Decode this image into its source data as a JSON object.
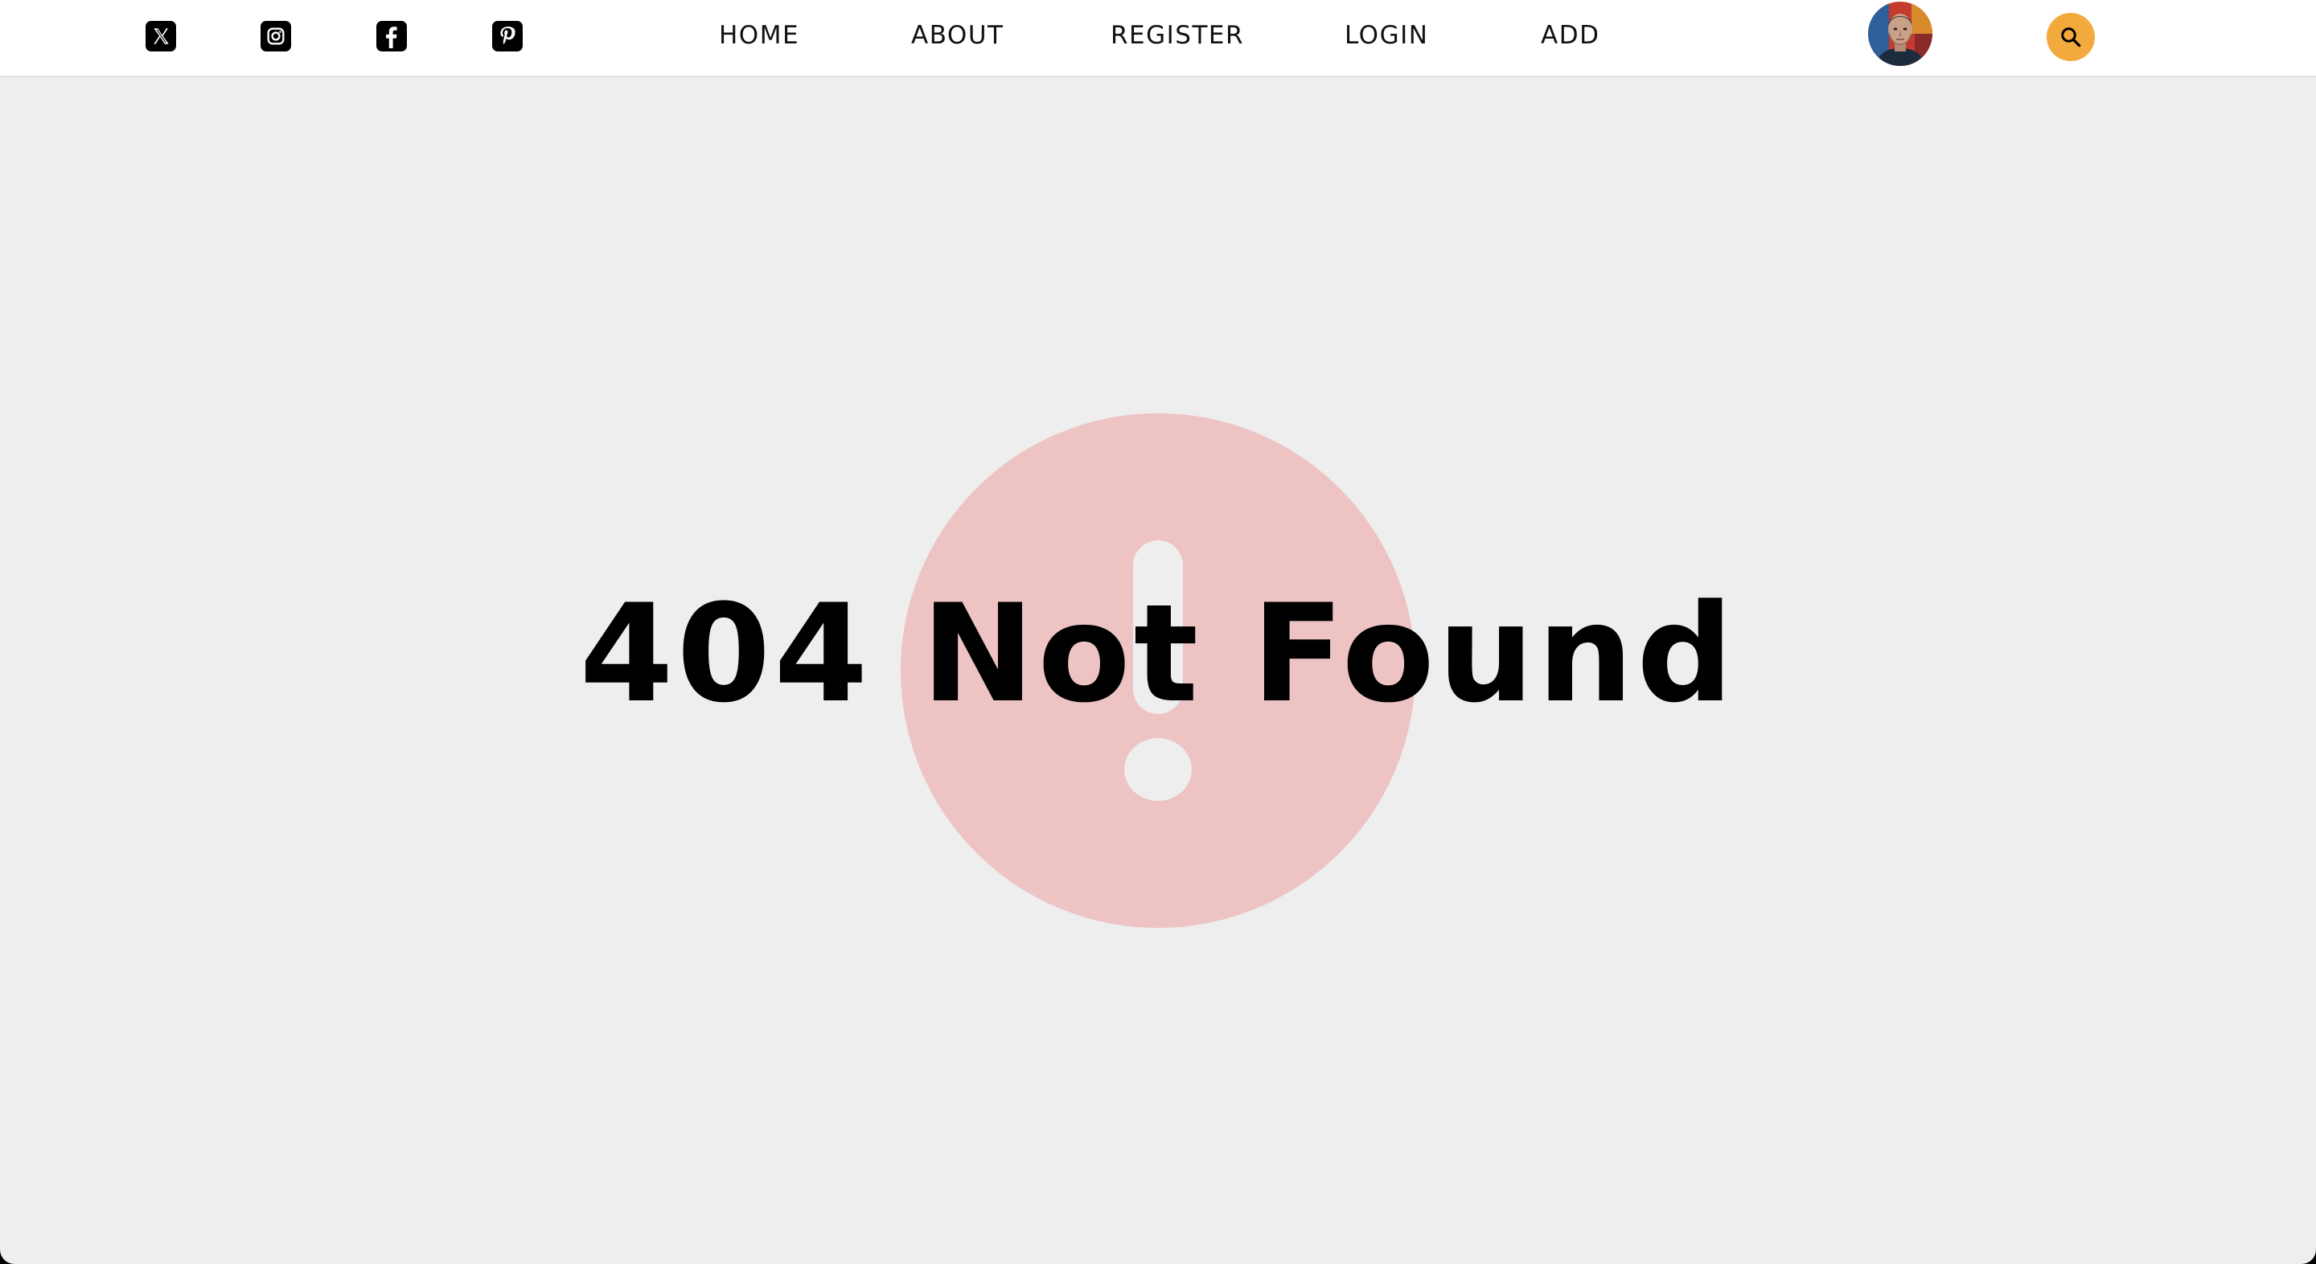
{
  "navbar": {
    "social": [
      {
        "name": "x-twitter-icon"
      },
      {
        "name": "instagram-icon"
      },
      {
        "name": "facebook-icon"
      },
      {
        "name": "pinterest-icon"
      }
    ],
    "links": [
      {
        "label": "HOME"
      },
      {
        "label": "ABOUT"
      },
      {
        "label": "REGISTER"
      },
      {
        "label": "LOGIN"
      },
      {
        "label": "ADD"
      }
    ],
    "avatar_icon": "user-avatar",
    "search_icon": "search-icon",
    "search_color": "#f3aa3c"
  },
  "main": {
    "title": "404 Not Found",
    "error_icon": "exclamation-circle-icon",
    "error_color": "#eec3c3",
    "background": "#eeeeee"
  }
}
